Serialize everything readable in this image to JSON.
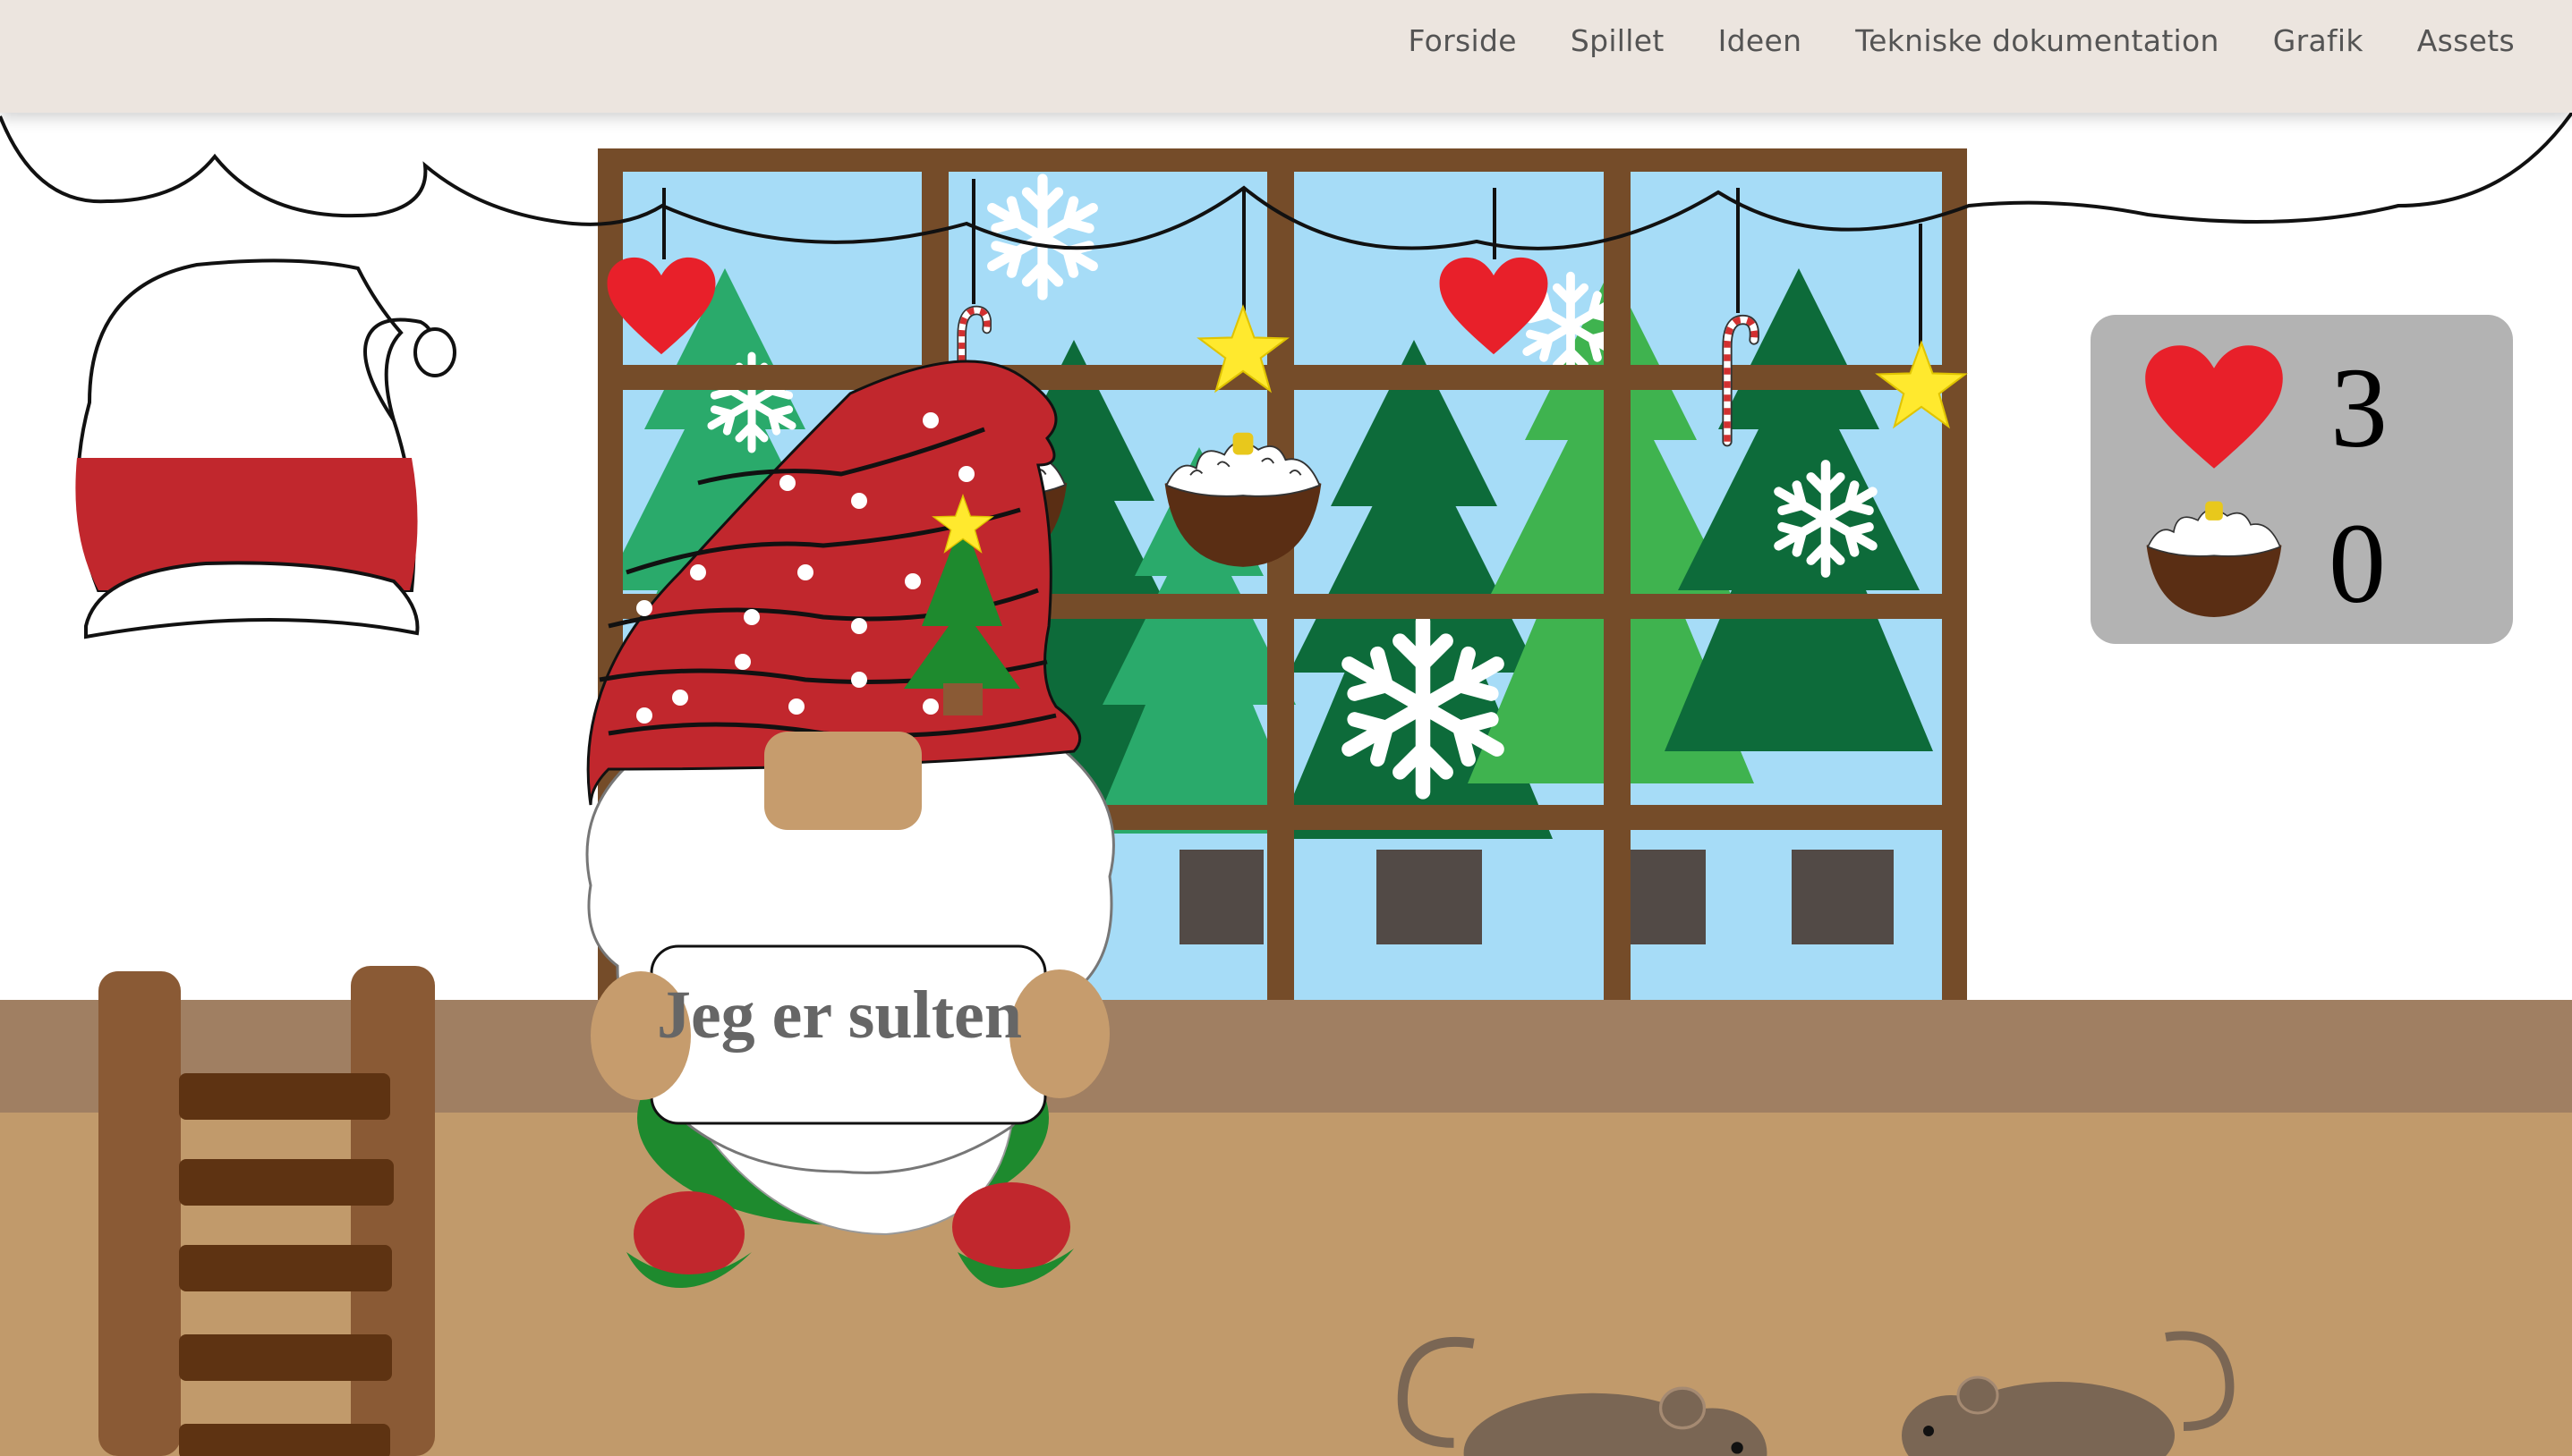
{
  "nav": {
    "items": [
      {
        "label": "Forside"
      },
      {
        "label": "Spillet"
      },
      {
        "label": "Ideen"
      },
      {
        "label": "Tekniske dokumentation"
      },
      {
        "label": "Grafik"
      },
      {
        "label": "Assets"
      }
    ]
  },
  "game": {
    "sign_text": "Jeg er sulten",
    "hunger_level": 0.5,
    "score": {
      "lives": "3",
      "puddings": "0"
    }
  },
  "colors": {
    "nav_bg": "#ece5df",
    "wall": "#ffffff",
    "floor": "#c19a6b",
    "baseboard": "#a07f62",
    "window_frame": "#754c29",
    "sky": "#a6dcf7",
    "heart": "#e8202a",
    "hat_red": "#c1272d",
    "score_panel": "#b3b3b3"
  },
  "icons": [
    "heart-icon",
    "pudding-icon",
    "santa-hat-icon",
    "star-icon",
    "candy-cane-icon",
    "snowflake-icon",
    "mouse-icon",
    "ladder-icon"
  ]
}
